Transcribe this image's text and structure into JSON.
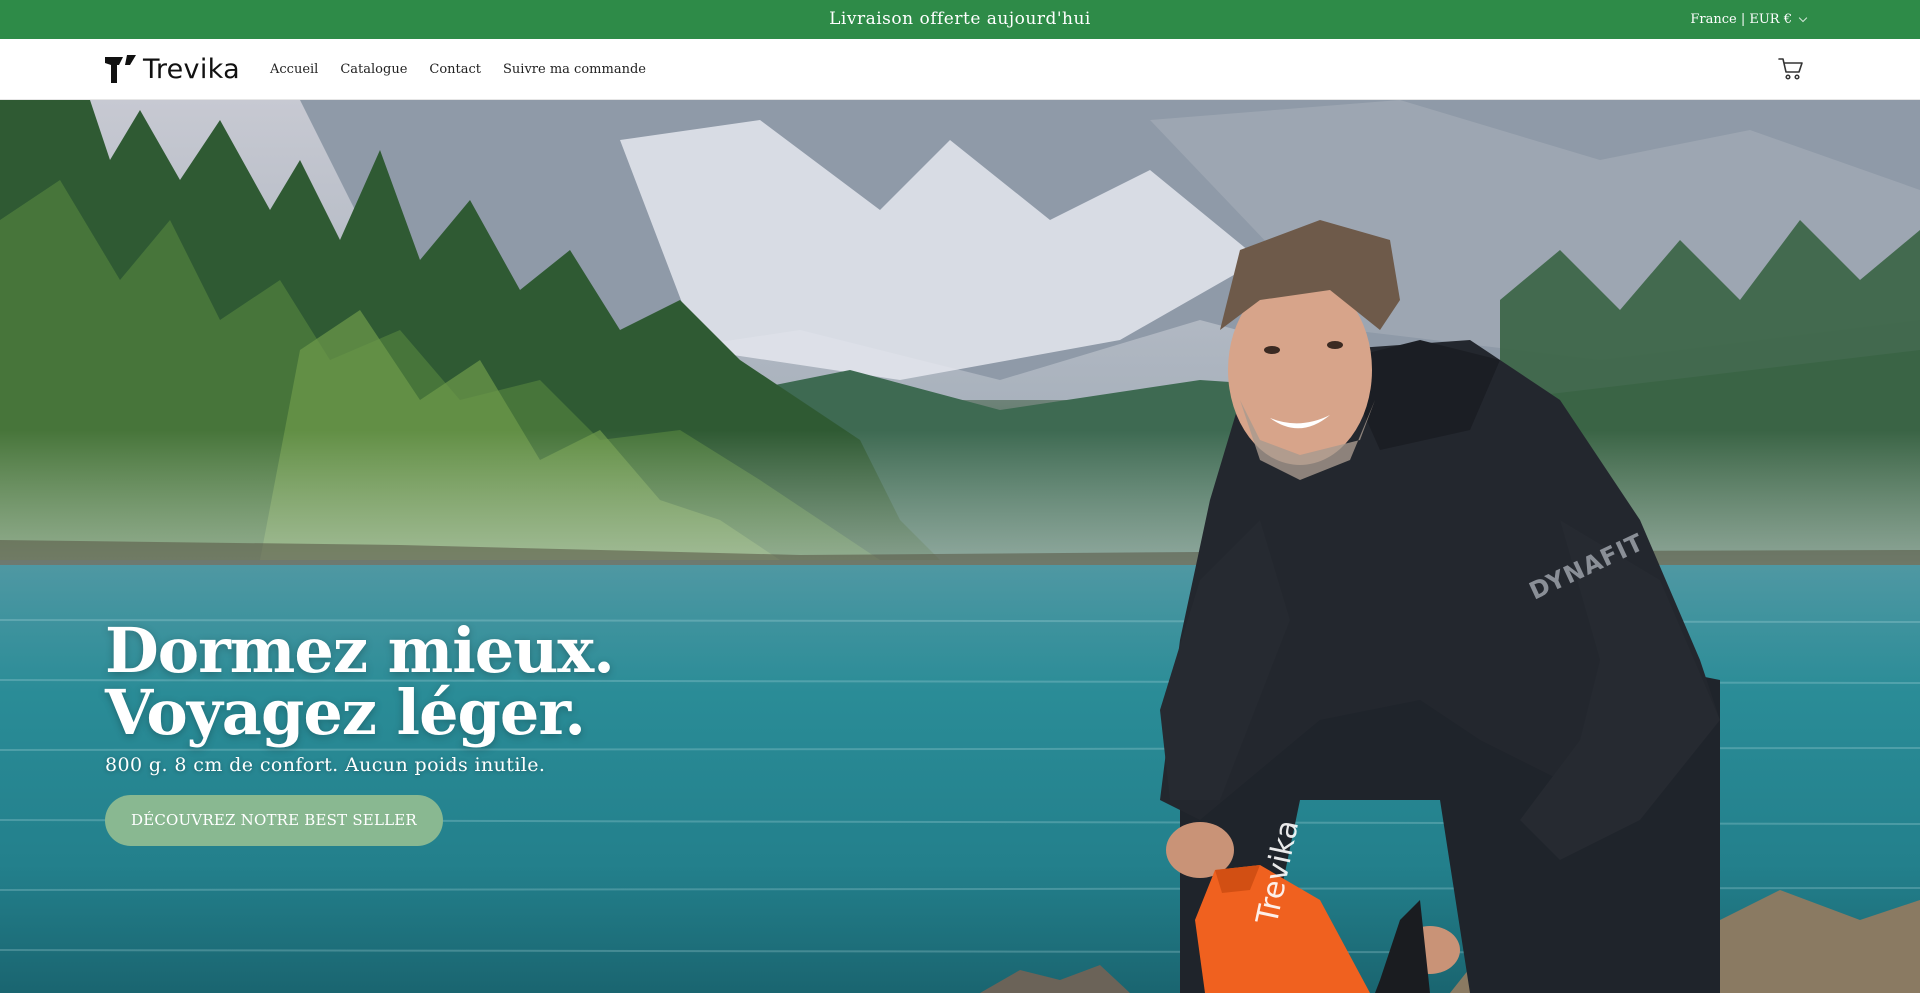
{
  "announcement": {
    "text": "Livraison offerte aujourd'hui",
    "locale": "France | EUR €"
  },
  "header": {
    "brand": "Trevika",
    "nav": [
      {
        "label": "Accueil"
      },
      {
        "label": "Catalogue"
      },
      {
        "label": "Contact"
      },
      {
        "label": "Suivre ma commande"
      }
    ],
    "cart_icon": "cart-icon"
  },
  "hero": {
    "headline_line1": "Dormez mieux.",
    "headline_line2": "Voyagez léger.",
    "subline": "800 g. 8 cm de confort. Aucun poids inutile.",
    "cta_label": "DÉCOUVREZ NOTRE BEST SELLER",
    "product_bag_text": "Trevika",
    "jacket_brand_text": "DYNAFIT"
  },
  "colors": {
    "announcement_bg": "#2e8b48",
    "cta_bg": "#89b891",
    "bag_orange": "#f0611f"
  }
}
